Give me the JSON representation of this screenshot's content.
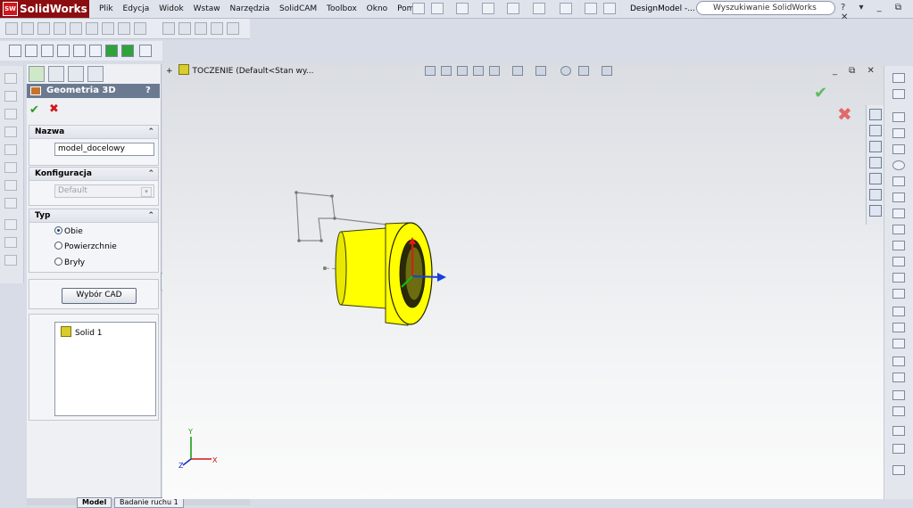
{
  "app": {
    "name": "SolidWorks",
    "logo_abbr": "SW"
  },
  "menu": [
    "Plik",
    "Edycja",
    "Widok",
    "Wstaw",
    "Narzędzia",
    "SolidCAM",
    "Toolbox",
    "Okno",
    "Pomoc"
  ],
  "document_name": "DesignModel -...",
  "search": {
    "placeholder": "Wyszukiwanie SolidWorks"
  },
  "property_manager": {
    "title": "Geometria 3D",
    "help": "?",
    "ok_symbol": "✔",
    "cancel_symbol": "✖",
    "groups": {
      "name": {
        "label": "Nazwa",
        "value": "model_docelowy"
      },
      "config": {
        "label": "Konfiguracja",
        "value": "Default"
      },
      "type": {
        "label": "Typ",
        "options": [
          "Obie",
          "Powierzchnie",
          "Bryły"
        ],
        "selected": "Obie"
      },
      "cad": {
        "button": "Wybór CAD"
      },
      "list": {
        "items": [
          "Solid 1"
        ]
      }
    }
  },
  "bottom_tabs": [
    "Model",
    "Badanie ruchu 1"
  ],
  "viewport": {
    "tree_label": "TOCZENIE  (Default<Stan wy...",
    "axis_labels": {
      "x": "X",
      "y": "Y",
      "z": "Z"
    },
    "part_color": "#ffff00",
    "accept_symbol": "✔",
    "reject_symbol": "✖",
    "window_controls": "_ ⧉ ✕"
  },
  "colors": {
    "pm_header": "#6b7a91",
    "logo_bg": "#8b0d10",
    "ok_green": "#2a9a2a",
    "cancel_red": "#d21818"
  }
}
